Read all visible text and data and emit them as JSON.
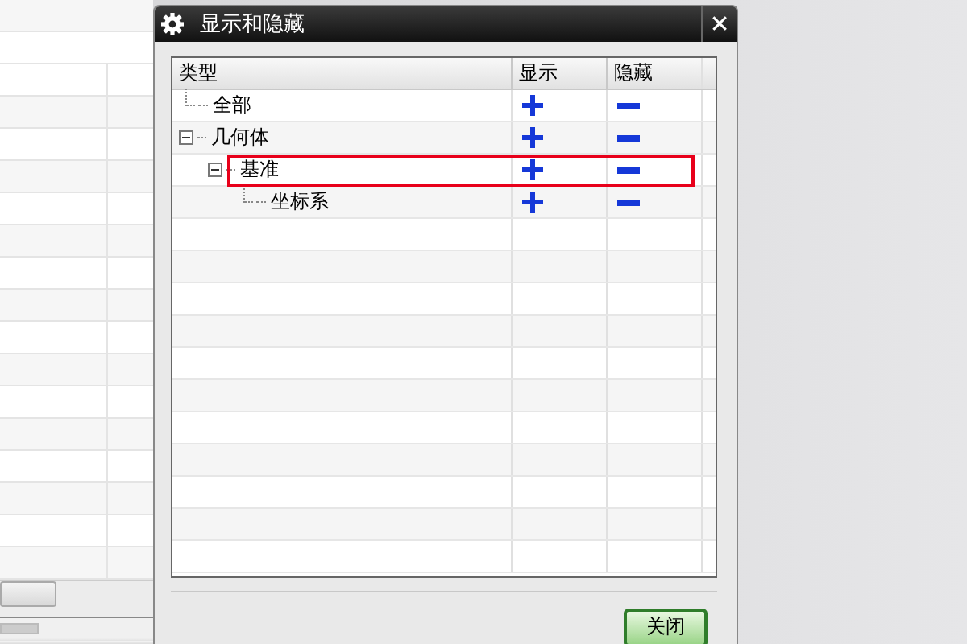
{
  "dialog": {
    "title": "显示和隐藏",
    "close_label": "✕",
    "button": "关闭"
  },
  "table": {
    "columns": [
      "类型",
      "显示",
      "隐藏"
    ],
    "rows": [
      {
        "label": "全部",
        "highlighted": false
      },
      {
        "label": "几何体",
        "expanded": true,
        "highlighted": false,
        "children": [
          {
            "label": "基准",
            "expanded": true,
            "highlighted": true,
            "children": [
              {
                "label": "坐标系",
                "highlighted": false
              }
            ]
          }
        ]
      }
    ]
  }
}
